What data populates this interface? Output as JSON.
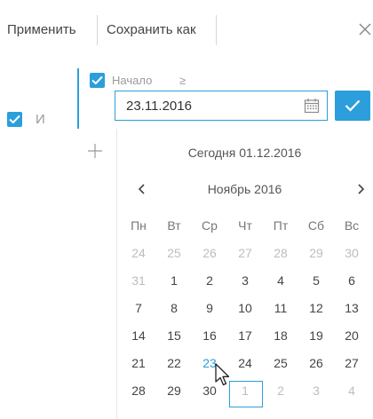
{
  "toolbar": {
    "apply_label": "Применить",
    "save_as_label": "Сохранить как",
    "close_icon": "close-icon"
  },
  "filter_group": {
    "operator_label": "И",
    "checked": true
  },
  "condition": {
    "column_label": "Начало",
    "comparison": "≥",
    "checked": true,
    "value": "23.11.2016"
  },
  "calendar": {
    "today_text": "Сегодня 01.12.2016",
    "month_title": "Ноябрь 2016",
    "weekdays": [
      "Пн",
      "Вт",
      "Ср",
      "Чт",
      "Пт",
      "Сб",
      "Вс"
    ],
    "weeks": [
      [
        {
          "d": "24",
          "o": true
        },
        {
          "d": "25",
          "o": true
        },
        {
          "d": "26",
          "o": true
        },
        {
          "d": "27",
          "o": true
        },
        {
          "d": "28",
          "o": true
        },
        {
          "d": "29",
          "o": true
        },
        {
          "d": "30",
          "o": true
        }
      ],
      [
        {
          "d": "31",
          "o": true
        },
        {
          "d": "1"
        },
        {
          "d": "2"
        },
        {
          "d": "3"
        },
        {
          "d": "4"
        },
        {
          "d": "5"
        },
        {
          "d": "6"
        }
      ],
      [
        {
          "d": "7"
        },
        {
          "d": "8"
        },
        {
          "d": "9"
        },
        {
          "d": "10"
        },
        {
          "d": "11"
        },
        {
          "d": "12"
        },
        {
          "d": "13"
        }
      ],
      [
        {
          "d": "14"
        },
        {
          "d": "15"
        },
        {
          "d": "16"
        },
        {
          "d": "17"
        },
        {
          "d": "18"
        },
        {
          "d": "19"
        },
        {
          "d": "20"
        }
      ],
      [
        {
          "d": "21"
        },
        {
          "d": "22"
        },
        {
          "d": "23",
          "sel": true
        },
        {
          "d": "24"
        },
        {
          "d": "25"
        },
        {
          "d": "26"
        },
        {
          "d": "27"
        }
      ],
      [
        {
          "d": "28"
        },
        {
          "d": "29"
        },
        {
          "d": "30"
        },
        {
          "d": "1",
          "o": true,
          "today": true
        },
        {
          "d": "2",
          "o": true
        },
        {
          "d": "3",
          "o": true
        },
        {
          "d": "4",
          "o": true
        }
      ]
    ]
  },
  "colors": {
    "accent": "#2b9edb",
    "muted_text": "#9a9a9a",
    "other_month_text": "#bdbdbd"
  }
}
